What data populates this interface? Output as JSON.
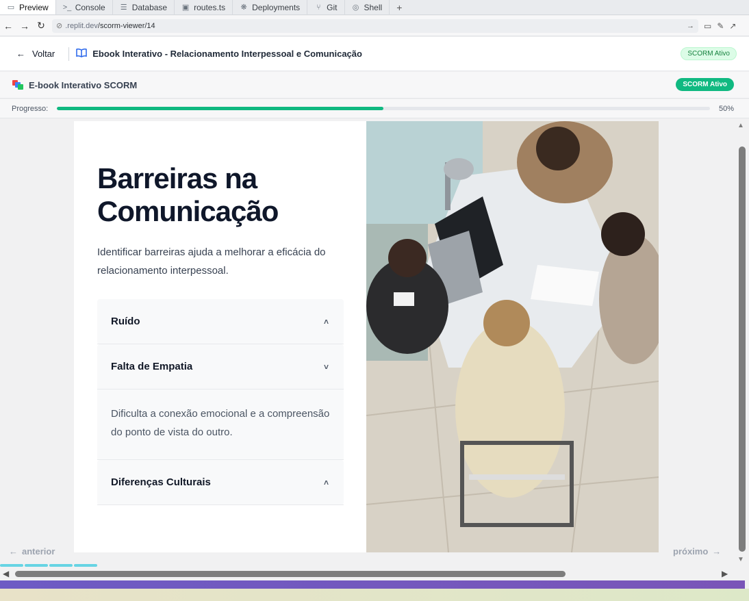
{
  "tabs": [
    {
      "label": "Preview",
      "icon": "monitor-icon",
      "glyph": "▭",
      "active": true
    },
    {
      "label": "Console",
      "icon": "terminal-icon",
      "glyph": ">_",
      "active": false
    },
    {
      "label": "Database",
      "icon": "database-icon",
      "glyph": "☰",
      "active": false
    },
    {
      "label": "routes.ts",
      "icon": "typescript-file-icon",
      "glyph": "▣",
      "active": false
    },
    {
      "label": "Deployments",
      "icon": "deployments-icon",
      "glyph": "❋",
      "active": false
    },
    {
      "label": "Git",
      "icon": "git-icon",
      "glyph": "⑂",
      "active": false
    },
    {
      "label": "Shell",
      "icon": "shell-icon",
      "glyph": "◎",
      "active": false
    }
  ],
  "address": {
    "url_host": ".replit.dev",
    "url_path": "/scorm-viewer/14"
  },
  "header": {
    "back_label": "Voltar",
    "title": "Ebook Interativo - Relacionamento Interpessoal e Comunicação",
    "status_badge": "SCORM Ativo"
  },
  "scorm": {
    "name": "E-book Interativo SCORM",
    "status_badge": "SCORM Ativo"
  },
  "progress": {
    "label": "Progresso:",
    "value": 0.5,
    "text": "50%"
  },
  "page": {
    "heading": "Barreiras na Comunicação",
    "intro": "Identificar barreiras ajuda a melhorar a eficácia do relacionamento interpessoal.",
    "accordion": [
      {
        "title": "Ruído",
        "expanded": false,
        "chevron": "˄"
      },
      {
        "title": "Falta de Empatia",
        "expanded": true,
        "chevron": "˅",
        "body": "Dificulta a conexão emocional e a compreensão do ponto de vista do outro."
      },
      {
        "title": "Diferenças Culturais",
        "expanded": false,
        "chevron": "˄"
      }
    ],
    "image_alt": "business meeting photo"
  },
  "pager": {
    "prev_label": "anterior",
    "next_label": "próximo"
  },
  "colors": {
    "accent_green": "#10b981",
    "heading": "#0f172a",
    "link_blue": "#2563eb"
  }
}
